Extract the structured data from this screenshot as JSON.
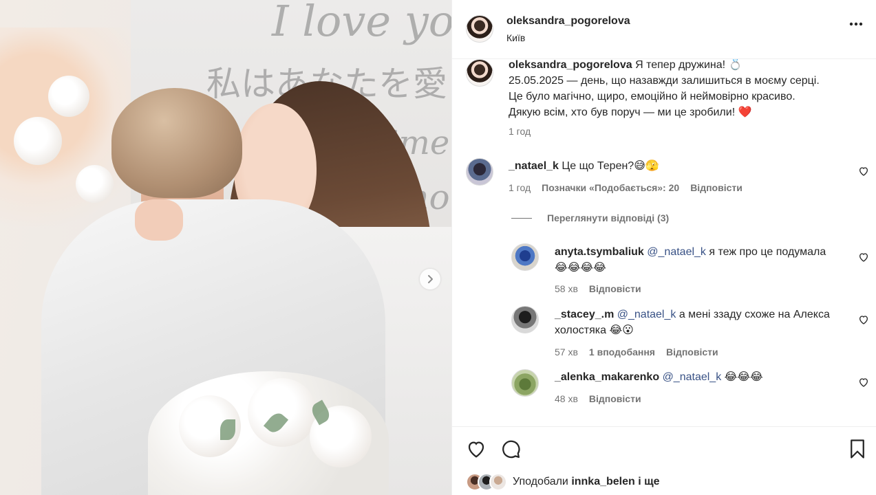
{
  "post": {
    "username": "oleksandra_pogorelova",
    "location": "Київ",
    "caption": {
      "username": "oleksandra_pogorelova",
      "line1": "Я тепер дружина! 💍",
      "line2": "25.05.2025 — день, що назавжди залишиться в моєму серці.",
      "line3": "Це було магічно, щиро, емоційно й неймовірно красиво.",
      "line4": "Дякую всім, хто був поруч — ми це зробили! ❤️",
      "time": "1 год"
    },
    "photo_text": {
      "script1": "I love you",
      "script2": "私はあなたを愛",
      "script3": "Je t'aime kohan",
      "script4": "Amo"
    }
  },
  "comments": [
    {
      "username": "_natael_k",
      "text": "Це що Терен?😅🫣",
      "time": "1 год",
      "likes": "Позначки «Подобається»: 20",
      "reply": "Відповісти",
      "view_replies": "Переглянути відповіді (3)"
    }
  ],
  "replies": [
    {
      "username": "anyta.tsymbaliuk",
      "mention": "@_natael_k",
      "text": " я теж про це подумала",
      "text2": "😂😂😂😂",
      "time": "58 хв",
      "reply": "Відповісти"
    },
    {
      "username": "_stacey_.m",
      "mention": "@_natael_k",
      "text": " а мені ззаду схоже на Алекса",
      "text2": "холостяка 😂😮",
      "time": "57 хв",
      "likes": "1 вподобання",
      "reply": "Відповісти"
    },
    {
      "username": "_alenka_makarenko",
      "mention": "@_natael_k",
      "text": " 😂😂😂",
      "time": "48 хв",
      "reply": "Відповісти"
    }
  ],
  "footer": {
    "liked_prefix": "Уподобали ",
    "liked_user": "innka_belen",
    "liked_suffix": " і ще"
  },
  "icons": {
    "more": "more-horizontal-icon",
    "heart": "heart-icon",
    "comment": "comment-icon",
    "bookmark": "bookmark-icon",
    "next": "chevron-right-icon"
  },
  "colors": {
    "text": "#262626",
    "secondary": "#737373",
    "mention": "#385185",
    "border": "#efefef"
  }
}
